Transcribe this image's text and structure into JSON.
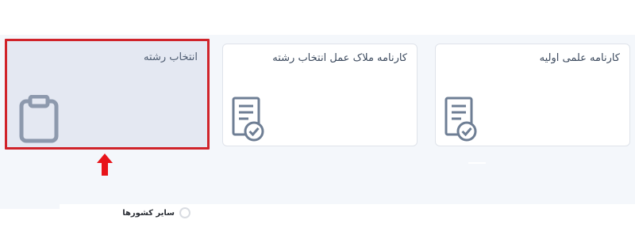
{
  "cards": [
    {
      "title": "کارنامه علمی اولیه",
      "icon": "report-check-icon"
    },
    {
      "title": "کارنامه ملاک عمل انتخاب رشته",
      "icon": "report-check-icon"
    },
    {
      "title": "انتخاب رشته",
      "icon": "clipboard-icon",
      "highlighted": true
    }
  ],
  "options": [
    {
      "label": "سایر کشورها",
      "selected": false
    }
  ],
  "colors": {
    "highlight_border": "#d0232a",
    "arrow": "#e8141a",
    "icon_stroke": "#6e7e94"
  }
}
